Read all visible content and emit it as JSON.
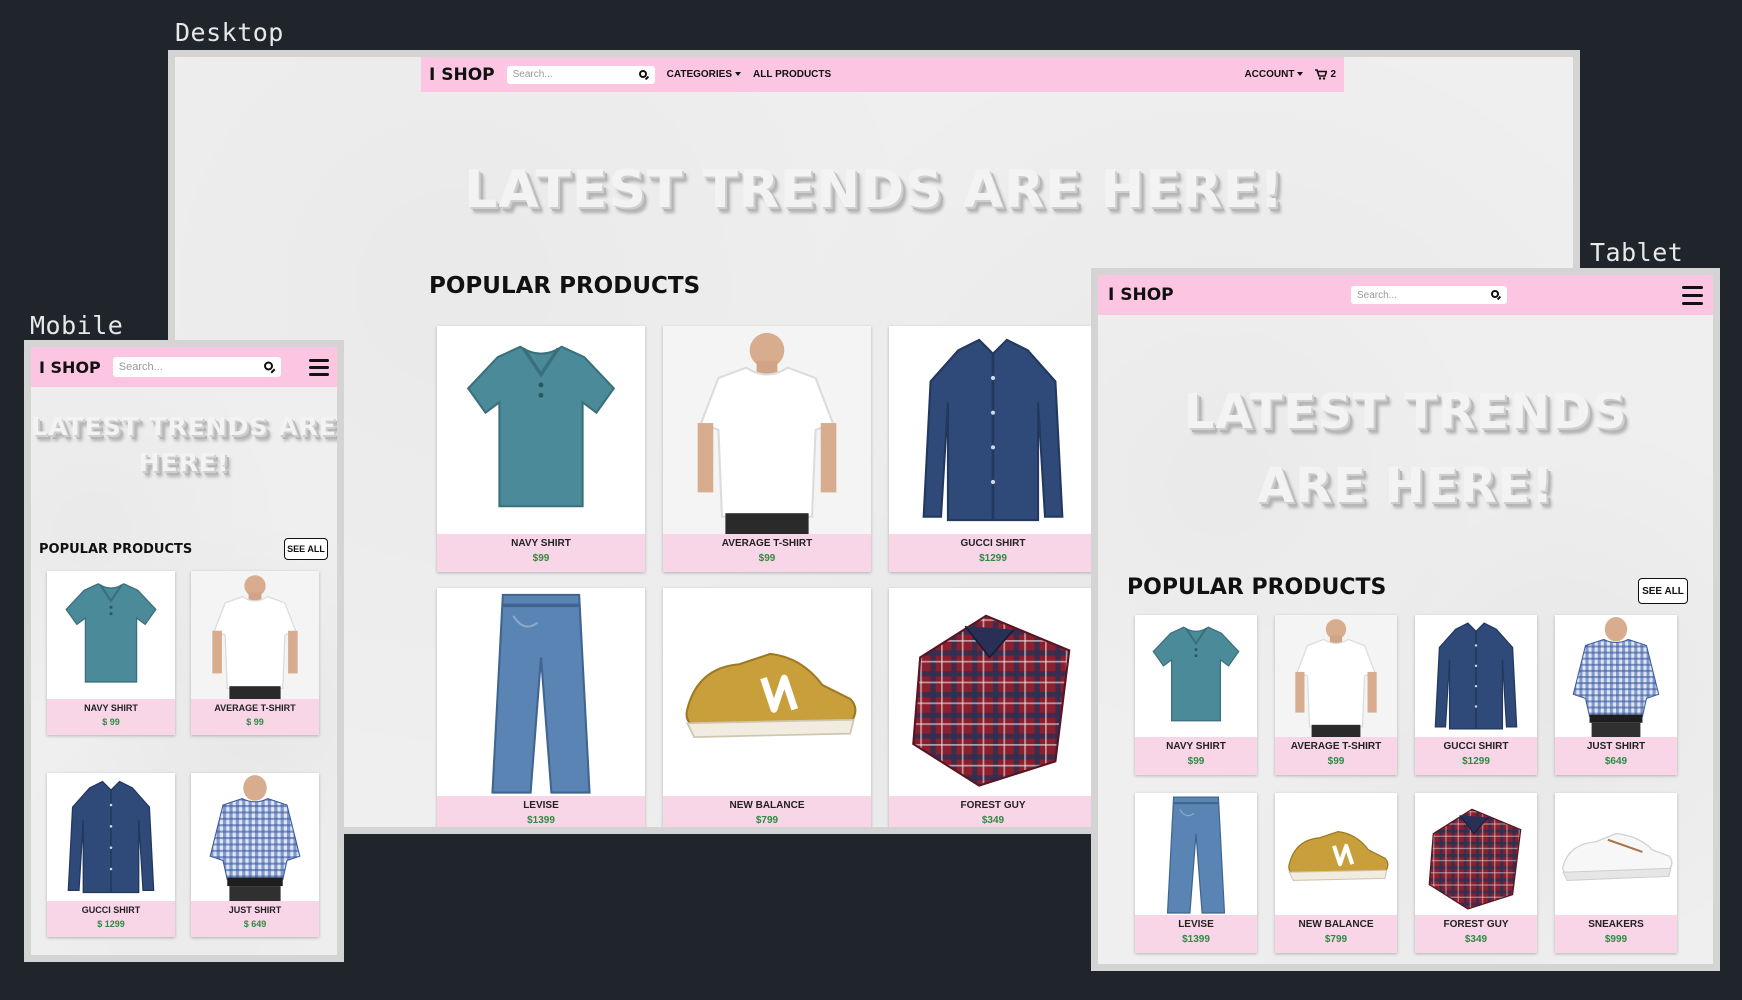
{
  "labels": {
    "desktop": "Desktop",
    "tablet": "Tablet",
    "mobile": "Mobile"
  },
  "brand": "I SHOP",
  "search_placeholder": "Search...",
  "nav": {
    "categories": "CATEGORIES",
    "all_products": "ALL PRODUCTS",
    "account": "ACCOUNT",
    "cart_count": "2"
  },
  "hero": {
    "desktop": "LATEST TRENDS ARE HERE!",
    "tablet_line1": "LATEST TRENDS",
    "tablet_line2": "ARE HERE!",
    "mobile_line1": "LATEST TRENDS ARE",
    "mobile_line2": "HERE!"
  },
  "section_title": "POPULAR PRODUCTS",
  "see_all": "SEE ALL",
  "colors": {
    "navbar": "#fcc6e2",
    "card": "#f8d5e7",
    "price": "#2f8a43",
    "background": "#20252c"
  },
  "products": [
    {
      "name": "NAVY SHIRT",
      "price": "$99",
      "price_mobile": "$ 99",
      "icon": "polo-shirt-icon"
    },
    {
      "name": "AVERAGE T-SHIRT",
      "price": "$99",
      "price_mobile": "$ 99",
      "icon": "t-shirt-icon"
    },
    {
      "name": "GUCCI SHIRT",
      "price": "$1299",
      "price_mobile": "$ 1299",
      "icon": "dress-shirt-icon"
    },
    {
      "name": "JUST SHIRT",
      "price": "$649",
      "price_mobile": "$ 649",
      "icon": "checked-shirt-icon"
    },
    {
      "name": "LEVISE",
      "price": "$1399",
      "icon": "jeans-icon"
    },
    {
      "name": "NEW BALANCE",
      "price": "$799",
      "icon": "sneaker-icon"
    },
    {
      "name": "FOREST GUY",
      "price": "$349",
      "icon": "plaid-shirt-icon"
    },
    {
      "name": "SNEAKERS",
      "price": "$999",
      "icon": "white-sneaker-icon"
    }
  ]
}
